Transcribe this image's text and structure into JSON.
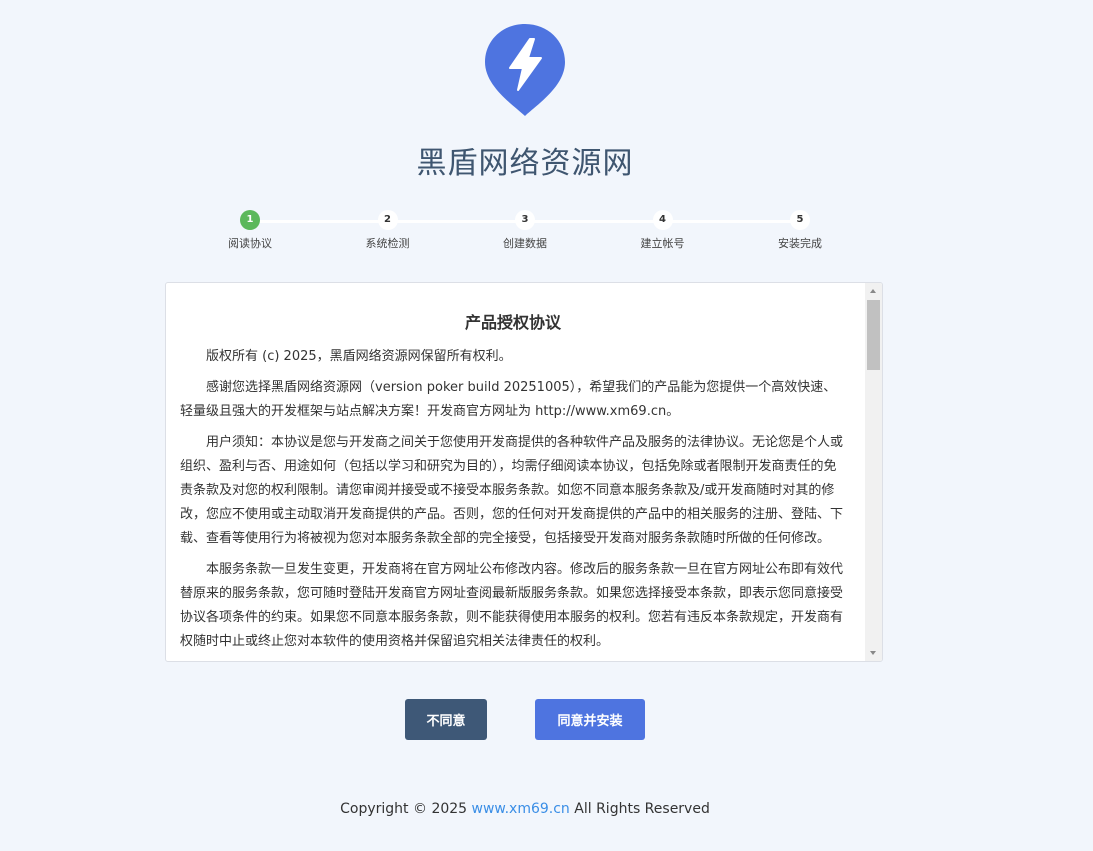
{
  "brand": {
    "logo_icon": "lightning-bolt-icon",
    "logo_color": "#4e74e0",
    "title": "黑盾网络资源网"
  },
  "steps": [
    {
      "number": "1",
      "label": "阅读协议",
      "active": true
    },
    {
      "number": "2",
      "label": "系统检测",
      "active": false
    },
    {
      "number": "3",
      "label": "创建数据",
      "active": false
    },
    {
      "number": "4",
      "label": "建立帐号",
      "active": false
    },
    {
      "number": "5",
      "label": "安装完成",
      "active": false
    }
  ],
  "license": {
    "title": "产品授权协议",
    "paragraphs": [
      "版权所有 (c) 2025，黑盾网络资源网保留所有权利。",
      "感谢您选择黑盾网络资源网（version poker build 20251005），希望我们的产品能为您提供一个高效快速、轻量级且强大的开发框架与站点解决方案！开发商官方网址为 http://www.xm69.cn。",
      "用户须知：本协议是您与开发商之间关于您使用开发商提供的各种软件产品及服务的法律协议。无论您是个人或组织、盈利与否、用途如何（包括以学习和研究为目的），均需仔细阅读本协议，包括免除或者限制开发商责任的免责条款及对您的权利限制。请您审阅并接受或不接受本服务条款。如您不同意本服务条款及/或开发商随时对其的修改，您应不使用或主动取消开发商提供的产品。否则，您的任何对开发商提供的产品中的相关服务的注册、登陆、下载、查看等使用行为将被视为您对本服务条款全部的完全接受，包括接受开发商对服务条款随时所做的任何修改。",
      "本服务条款一旦发生变更，开发商将在官方网址公布修改内容。修改后的服务条款一旦在官方网址公布即有效代替原来的服务条款，您可随时登陆开发商官方网址查阅最新版服务条款。如果您选择接受本条款，即表示您同意接受协议各项条件的约束。如果您不同意本服务条款，则不能获得使用本服务的权利。您若有违反本条款规定，开发商有权随时中止或终止您对本软件的使用资格并保留追究相关法律责任的权利。"
    ]
  },
  "buttons": {
    "disagree": "不同意",
    "agree": "同意并安装"
  },
  "footer": {
    "prefix": "Copyright © 2025",
    "link": "www.xm69.cn",
    "suffix": "All Rights Reserved"
  }
}
